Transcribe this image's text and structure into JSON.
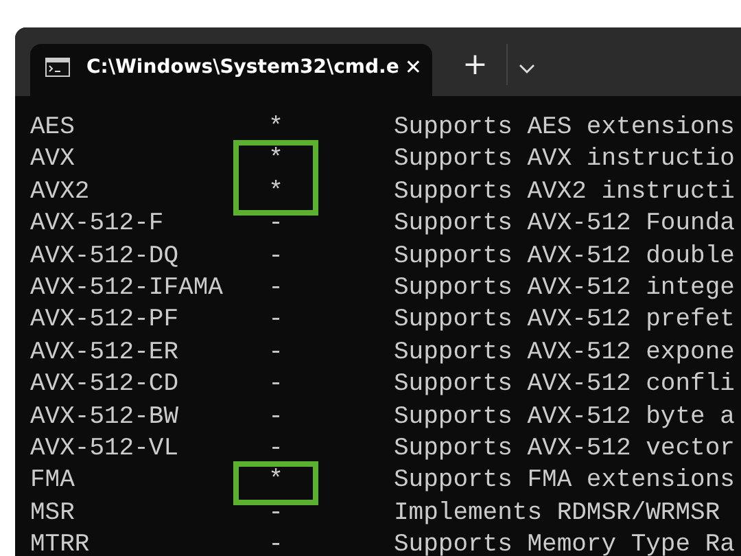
{
  "tab": {
    "title": "C:\\Windows\\System32\\cmd.e",
    "close": "✕",
    "selected": true
  },
  "new_tab": "+",
  "rows": [
    {
      "name": "AES",
      "flag": "*",
      "description": "Supports AES extensions",
      "highlighted": false
    },
    {
      "name": "AVX",
      "flag": "*",
      "description": "Supports AVX instructio",
      "highlighted": true
    },
    {
      "name": "AVX2",
      "flag": "*",
      "description": "Supports AVX2 instructi",
      "highlighted": true
    },
    {
      "name": "AVX-512-F",
      "flag": "-",
      "description": "Supports AVX-512 Founda",
      "highlighted": false
    },
    {
      "name": "AVX-512-DQ",
      "flag": "-",
      "description": "Supports AVX-512 double",
      "highlighted": false
    },
    {
      "name": "AVX-512-IFAMA",
      "flag": "-",
      "description": "Supports AVX-512 intege",
      "highlighted": false
    },
    {
      "name": "AVX-512-PF",
      "flag": "-",
      "description": "Supports AVX-512 prefet",
      "highlighted": false
    },
    {
      "name": "AVX-512-ER",
      "flag": "-",
      "description": "Supports AVX-512 expone",
      "highlighted": false
    },
    {
      "name": "AVX-512-CD",
      "flag": "-",
      "description": "Supports AVX-512 confli",
      "highlighted": false
    },
    {
      "name": "AVX-512-BW",
      "flag": "-",
      "description": "Supports AVX-512 byte a",
      "highlighted": false
    },
    {
      "name": "AVX-512-VL",
      "flag": "-",
      "description": "Supports AVX-512 vector",
      "highlighted": false
    },
    {
      "name": "FMA",
      "flag": "*",
      "description": "Supports FMA extensions",
      "highlighted": true
    },
    {
      "name": "MSR",
      "flag": "-",
      "description": "Implements RDMSR/WRMSR",
      "highlighted": false
    },
    {
      "name": "MTRR",
      "flag": "-",
      "description": "Supports Memory Type Ra",
      "highlighted": false
    }
  ]
}
